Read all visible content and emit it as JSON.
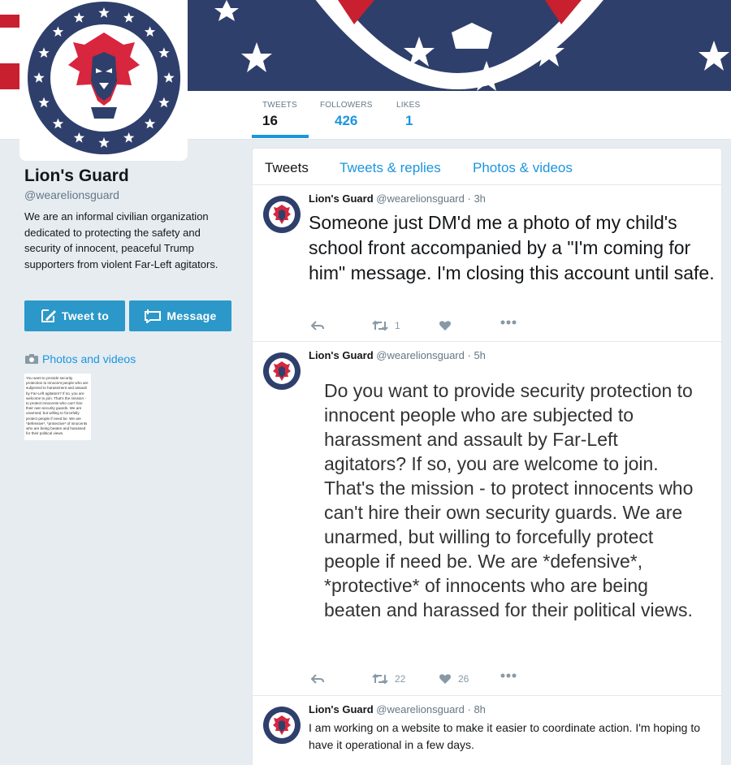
{
  "profile": {
    "name": "Lion's Guard",
    "handle": "@wearelionsguard",
    "bio": "We are an informal civilian organization dedicated to protecting the safety and security of innocent, peaceful Trump supporters from violent Far-Left agitators.",
    "tweet_to_label": "Tweet to",
    "message_label": "Message",
    "photos_link": "Photos and videos",
    "photo_thumb_text": "You want to provide security protection to innocent people who are subjected to harassment and assault by Far-Left agitators? If so, you are welcome to join. That's the mission - to protect innocents who can't hire their own security guards. We are unarmed, but willing to forcefully protect people if need be. We are *defensive*, *protective* of innocents who are being beaten and harassed for their political views."
  },
  "stats": [
    {
      "label": "TWEETS",
      "value": "16"
    },
    {
      "label": "FOLLOWERS",
      "value": "426"
    },
    {
      "label": "LIKES",
      "value": "1"
    }
  ],
  "tabs": [
    "Tweets",
    "Tweets & replies",
    "Photos & videos"
  ],
  "tweets": [
    {
      "name": "Lion's Guard",
      "handle": "@wearelionsguard",
      "time": "· 3h",
      "text": "Someone just DM'd me a photo of my child's school front accompanied by a \"I'm coming for him\" message. I'm closing this account until safe.",
      "retweets": "1",
      "likes": ""
    },
    {
      "name": "Lion's Guard",
      "handle": "@wearelionsguard",
      "time": "· 5h",
      "image_text": "Do you want to provide security protection to innocent people who are subjected to harassment and assault by Far-Left agitators? If so, you are welcome to join. That's the mission - to protect innocents who can't hire their own security guards. We are unarmed, but willing to forcefully protect people if need be. We are *defensive*, *protective* of innocents who are being beaten and harassed for their political views.",
      "retweets": "22",
      "likes": "26"
    },
    {
      "name": "Lion's Guard",
      "handle": "@wearelionsguard",
      "time": "· 8h",
      "text": "I am working on a website to make it easier to coordinate action. I'm hoping to have it operational in a few days."
    }
  ],
  "colors": {
    "accent": "#1b95e0",
    "button": "#2b98c9",
    "navy": "#2f3f6c",
    "red": "#d7263d"
  }
}
